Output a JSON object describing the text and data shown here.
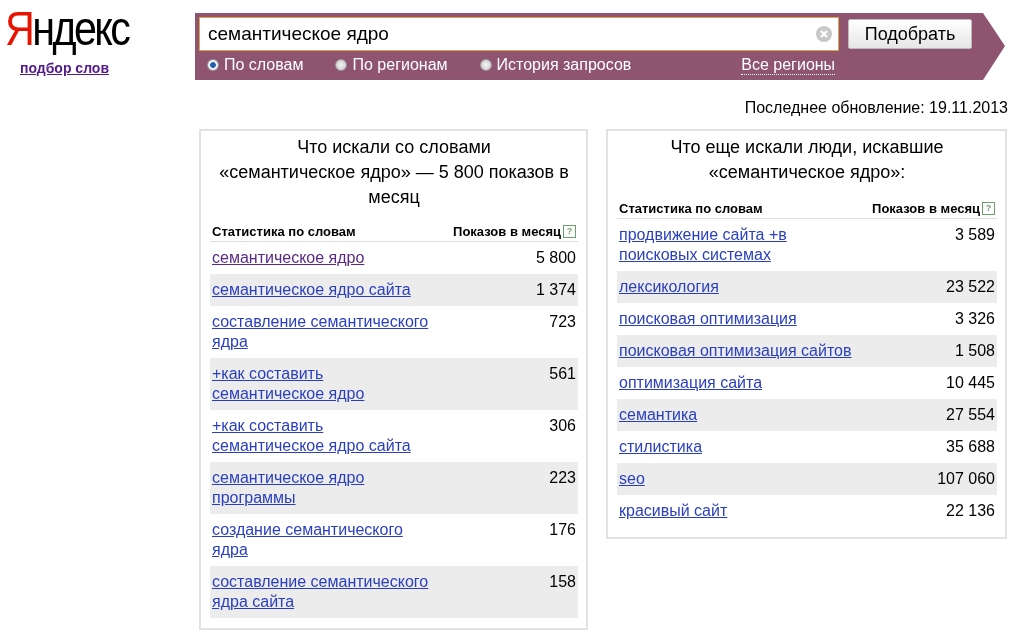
{
  "logo": {
    "first": "Я",
    "rest": "ндекс"
  },
  "service_link": "подбор слов",
  "search": {
    "value": "семантическое ядро",
    "button": "Подобрать",
    "modes": [
      {
        "label": "По словам",
        "selected": true
      },
      {
        "label": "По регионам",
        "selected": false
      },
      {
        "label": "История запросов",
        "selected": false
      }
    ],
    "region_link": "Все регионы"
  },
  "last_update": "Последнее обновление: 19.11.2013",
  "panels": [
    {
      "title": [
        "Что искали со словами",
        "«семантическое ядро» — 5 800 показов в месяц"
      ],
      "columns": [
        "Статистика по словам",
        "Показов в месяц"
      ],
      "help": "?",
      "rows": [
        {
          "phrase": "семантическое ядро",
          "count": "5 800",
          "visited": true
        },
        {
          "phrase": "семантическое ядро сайта",
          "count": "1 374",
          "visited": false
        },
        {
          "phrase": "составление семантического ядра",
          "count": "723",
          "visited": false
        },
        {
          "phrase": "+как составить семантическое ядро",
          "count": "561",
          "visited": false
        },
        {
          "phrase": "+как составить семантическое ядро сайта",
          "count": "306",
          "visited": false
        },
        {
          "phrase": "семантическое ядро программы",
          "count": "223",
          "visited": false
        },
        {
          "phrase": "создание семантического ядра",
          "count": "176",
          "visited": false
        },
        {
          "phrase": "составление семантического ядра сайта",
          "count": "158",
          "visited": false
        }
      ]
    },
    {
      "title": [
        "Что еще искали люди, искавшие",
        "«семантическое ядро»:"
      ],
      "columns": [
        "Статистика по словам",
        "Показов в месяц"
      ],
      "help": "?",
      "rows": [
        {
          "phrase": "продвижение сайта +в поисковых системах",
          "count": "3 589",
          "visited": false
        },
        {
          "phrase": "лексикология",
          "count": "23 522",
          "visited": false
        },
        {
          "phrase": "поисковая оптимизация",
          "count": "3 326",
          "visited": false
        },
        {
          "phrase": "поисковая оптимизация сайтов",
          "count": "1 508",
          "visited": false
        },
        {
          "phrase": "оптимизация сайта",
          "count": "10 445",
          "visited": false
        },
        {
          "phrase": "семантика",
          "count": "27 554",
          "visited": false
        },
        {
          "phrase": "стилистика",
          "count": "35 688",
          "visited": false
        },
        {
          "phrase": "seo",
          "count": "107 060",
          "visited": false
        },
        {
          "phrase": "красивый сайт",
          "count": "22 136",
          "visited": false
        }
      ]
    }
  ]
}
